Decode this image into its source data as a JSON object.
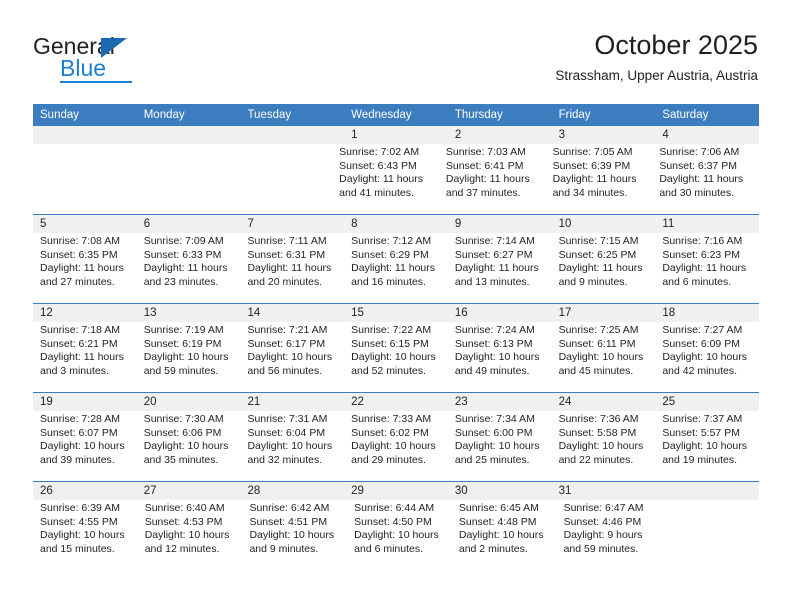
{
  "brand": {
    "name_top": "General",
    "name_bottom": "Blue",
    "accent_color": "#1b7fd4",
    "triangle_color": "#1b6ab0"
  },
  "header": {
    "month_title": "October 2025",
    "location": "Strassham, Upper Austria, Austria"
  },
  "theme": {
    "header_row_bg": "#3b7dbf",
    "date_band_bg": "#f0f0f0",
    "text_color": "#231f20",
    "page_bg": "#ffffff"
  },
  "calendar": {
    "day_names": [
      "Sunday",
      "Monday",
      "Tuesday",
      "Wednesday",
      "Thursday",
      "Friday",
      "Saturday"
    ],
    "weeks": [
      {
        "days": [
          {
            "date": "",
            "lines": []
          },
          {
            "date": "",
            "lines": []
          },
          {
            "date": "",
            "lines": []
          },
          {
            "date": "1",
            "lines": [
              "Sunrise: 7:02 AM",
              "Sunset: 6:43 PM",
              "Daylight: 11 hours",
              "and 41 minutes."
            ]
          },
          {
            "date": "2",
            "lines": [
              "Sunrise: 7:03 AM",
              "Sunset: 6:41 PM",
              "Daylight: 11 hours",
              "and 37 minutes."
            ]
          },
          {
            "date": "3",
            "lines": [
              "Sunrise: 7:05 AM",
              "Sunset: 6:39 PM",
              "Daylight: 11 hours",
              "and 34 minutes."
            ]
          },
          {
            "date": "4",
            "lines": [
              "Sunrise: 7:06 AM",
              "Sunset: 6:37 PM",
              "Daylight: 11 hours",
              "and 30 minutes."
            ]
          }
        ]
      },
      {
        "days": [
          {
            "date": "5",
            "lines": [
              "Sunrise: 7:08 AM",
              "Sunset: 6:35 PM",
              "Daylight: 11 hours",
              "and 27 minutes."
            ]
          },
          {
            "date": "6",
            "lines": [
              "Sunrise: 7:09 AM",
              "Sunset: 6:33 PM",
              "Daylight: 11 hours",
              "and 23 minutes."
            ]
          },
          {
            "date": "7",
            "lines": [
              "Sunrise: 7:11 AM",
              "Sunset: 6:31 PM",
              "Daylight: 11 hours",
              "and 20 minutes."
            ]
          },
          {
            "date": "8",
            "lines": [
              "Sunrise: 7:12 AM",
              "Sunset: 6:29 PM",
              "Daylight: 11 hours",
              "and 16 minutes."
            ]
          },
          {
            "date": "9",
            "lines": [
              "Sunrise: 7:14 AM",
              "Sunset: 6:27 PM",
              "Daylight: 11 hours",
              "and 13 minutes."
            ]
          },
          {
            "date": "10",
            "lines": [
              "Sunrise: 7:15 AM",
              "Sunset: 6:25 PM",
              "Daylight: 11 hours",
              "and 9 minutes."
            ]
          },
          {
            "date": "11",
            "lines": [
              "Sunrise: 7:16 AM",
              "Sunset: 6:23 PM",
              "Daylight: 11 hours",
              "and 6 minutes."
            ]
          }
        ]
      },
      {
        "days": [
          {
            "date": "12",
            "lines": [
              "Sunrise: 7:18 AM",
              "Sunset: 6:21 PM",
              "Daylight: 11 hours",
              "and 3 minutes."
            ]
          },
          {
            "date": "13",
            "lines": [
              "Sunrise: 7:19 AM",
              "Sunset: 6:19 PM",
              "Daylight: 10 hours",
              "and 59 minutes."
            ]
          },
          {
            "date": "14",
            "lines": [
              "Sunrise: 7:21 AM",
              "Sunset: 6:17 PM",
              "Daylight: 10 hours",
              "and 56 minutes."
            ]
          },
          {
            "date": "15",
            "lines": [
              "Sunrise: 7:22 AM",
              "Sunset: 6:15 PM",
              "Daylight: 10 hours",
              "and 52 minutes."
            ]
          },
          {
            "date": "16",
            "lines": [
              "Sunrise: 7:24 AM",
              "Sunset: 6:13 PM",
              "Daylight: 10 hours",
              "and 49 minutes."
            ]
          },
          {
            "date": "17",
            "lines": [
              "Sunrise: 7:25 AM",
              "Sunset: 6:11 PM",
              "Daylight: 10 hours",
              "and 45 minutes."
            ]
          },
          {
            "date": "18",
            "lines": [
              "Sunrise: 7:27 AM",
              "Sunset: 6:09 PM",
              "Daylight: 10 hours",
              "and 42 minutes."
            ]
          }
        ]
      },
      {
        "days": [
          {
            "date": "19",
            "lines": [
              "Sunrise: 7:28 AM",
              "Sunset: 6:07 PM",
              "Daylight: 10 hours",
              "and 39 minutes."
            ]
          },
          {
            "date": "20",
            "lines": [
              "Sunrise: 7:30 AM",
              "Sunset: 6:06 PM",
              "Daylight: 10 hours",
              "and 35 minutes."
            ]
          },
          {
            "date": "21",
            "lines": [
              "Sunrise: 7:31 AM",
              "Sunset: 6:04 PM",
              "Daylight: 10 hours",
              "and 32 minutes."
            ]
          },
          {
            "date": "22",
            "lines": [
              "Sunrise: 7:33 AM",
              "Sunset: 6:02 PM",
              "Daylight: 10 hours",
              "and 29 minutes."
            ]
          },
          {
            "date": "23",
            "lines": [
              "Sunrise: 7:34 AM",
              "Sunset: 6:00 PM",
              "Daylight: 10 hours",
              "and 25 minutes."
            ]
          },
          {
            "date": "24",
            "lines": [
              "Sunrise: 7:36 AM",
              "Sunset: 5:58 PM",
              "Daylight: 10 hours",
              "and 22 minutes."
            ]
          },
          {
            "date": "25",
            "lines": [
              "Sunrise: 7:37 AM",
              "Sunset: 5:57 PM",
              "Daylight: 10 hours",
              "and 19 minutes."
            ]
          }
        ]
      },
      {
        "days": [
          {
            "date": "26",
            "lines": [
              "Sunrise: 6:39 AM",
              "Sunset: 4:55 PM",
              "Daylight: 10 hours",
              "and 15 minutes."
            ]
          },
          {
            "date": "27",
            "lines": [
              "Sunrise: 6:40 AM",
              "Sunset: 4:53 PM",
              "Daylight: 10 hours",
              "and 12 minutes."
            ]
          },
          {
            "date": "28",
            "lines": [
              "Sunrise: 6:42 AM",
              "Sunset: 4:51 PM",
              "Daylight: 10 hours",
              "and 9 minutes."
            ]
          },
          {
            "date": "29",
            "lines": [
              "Sunrise: 6:44 AM",
              "Sunset: 4:50 PM",
              "Daylight: 10 hours",
              "and 6 minutes."
            ]
          },
          {
            "date": "30",
            "lines": [
              "Sunrise: 6:45 AM",
              "Sunset: 4:48 PM",
              "Daylight: 10 hours",
              "and 2 minutes."
            ]
          },
          {
            "date": "31",
            "lines": [
              "Sunrise: 6:47 AM",
              "Sunset: 4:46 PM",
              "Daylight: 9 hours",
              "and 59 minutes."
            ]
          },
          {
            "date": "",
            "lines": []
          }
        ]
      }
    ]
  }
}
